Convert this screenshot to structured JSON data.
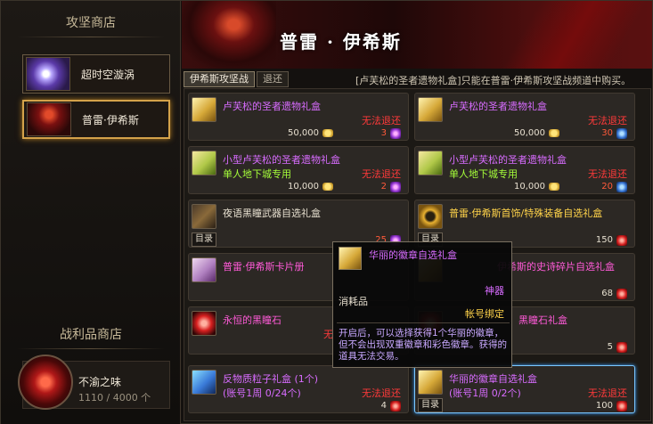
{
  "sidebar": {
    "shop_title": "攻坚商店",
    "items": [
      {
        "label": "超时空漩涡"
      },
      {
        "label": "普雷·伊希斯"
      }
    ],
    "trophy_title": "战利品商店",
    "trophy": {
      "name": "不渝之味",
      "count": "1110 / 4000 个"
    }
  },
  "banner": {
    "title": "普雷 · 伊希斯"
  },
  "tabs": [
    {
      "label": "伊希斯攻坚战"
    },
    {
      "label": "退还"
    }
  ],
  "notice": "[卢芙松的圣者遗物礼盒]只能在普雷·伊希斯攻坚战频道中购买。",
  "labels": {
    "catalog": "目录",
    "restrict": "无法退还"
  },
  "items": [
    {
      "name": "卢芙松的圣者遗物礼盒",
      "sub": "",
      "restrict": "无法退还",
      "price": "50,000",
      "points": "3",
      "gem": "purple",
      "icon": "gold-box-icon"
    },
    {
      "name": "卢芙松的圣者遗物礼盒",
      "sub": "",
      "restrict": "无法退还",
      "price": "50,000",
      "points": "30",
      "gem": "blue",
      "icon": "gold-box-icon"
    },
    {
      "name": "小型卢芙松的圣者遗物礼盒",
      "sub": "单人地下城专用",
      "restrict": "无法退还",
      "price": "10,000",
      "points": "2",
      "gem": "purple",
      "icon": "green-box-icon"
    },
    {
      "name": "小型卢芙松的圣者遗物礼盒",
      "sub": "单人地下城专用",
      "restrict": "无法退还",
      "price": "10,000",
      "points": "20",
      "gem": "blue",
      "icon": "green-box-icon"
    },
    {
      "name": "夜语黑瞳武器自选礼盒",
      "points": "25",
      "gem": "purple",
      "icon": "weapon-icon"
    },
    {
      "name": "普雷·伊希斯首饰/特殊装备自选礼盒",
      "points": "150",
      "gem": "red",
      "icon": "ring-icon"
    },
    {
      "name": "普雷·伊希斯卡片册",
      "points": "",
      "gem": "",
      "icon": "card-book-icon"
    },
    {
      "name": "伊希斯的史诗碎片自选礼盒",
      "points": "68",
      "gem": "red",
      "icon": "gold-box-icon"
    },
    {
      "name": "永恒的黑瞳石",
      "restrict": "无",
      "points": "",
      "gem": "",
      "icon": "red-orb-icon"
    },
    {
      "name": "黑瞳石礼盒",
      "points": "5",
      "gem": "red",
      "icon": "red-orb-icon"
    },
    {
      "name": "反物质粒子礼盒 (1个)",
      "sub": "(账号1周 0/24个)",
      "restrict": "无法退还",
      "points": "4",
      "gem": "red",
      "icon": "antimatter-box-icon"
    },
    {
      "name": "华丽的徽章自选礼盒",
      "sub": "(账号1周 0/2个)",
      "restrict": "无法退还",
      "points": "100",
      "gem": "red",
      "icon": "gold-box-icon"
    }
  ],
  "tooltip": {
    "name": "华丽的徽章自选礼盒",
    "rarity": "神器",
    "type": "消耗品",
    "bind": "帐号绑定",
    "desc": "开启后，可以选择获得1个华丽的徽章，但不会出现双重徽章和彩色徽章。获得的道具无法交易。"
  }
}
